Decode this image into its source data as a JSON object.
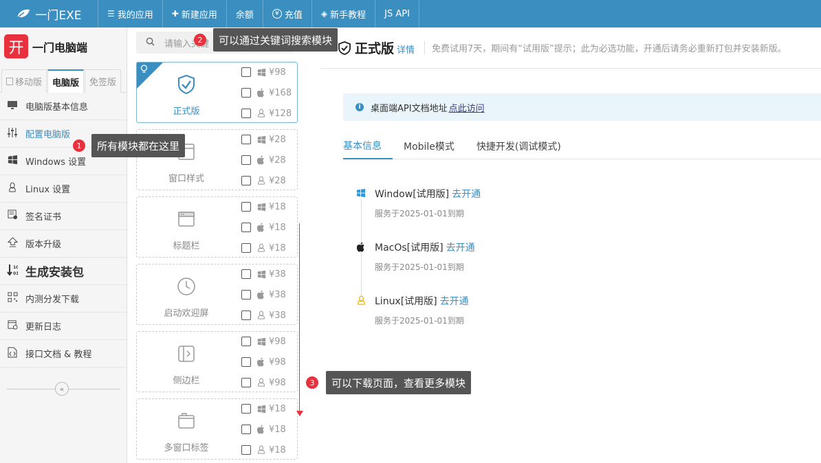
{
  "topbar": {
    "logo_text": "一门EXE",
    "nav": [
      {
        "icon": "hamburger-icon",
        "glyph": "☰",
        "label": "我的应用"
      },
      {
        "icon": "plus-icon",
        "glyph": "✚",
        "label": "新建应用"
      },
      {
        "icon": "",
        "glyph": "",
        "label": "余额"
      },
      {
        "icon": "yen-circle-icon",
        "glyph": "¥",
        "label": "充值"
      },
      {
        "icon": "diamond-icon",
        "glyph": "◈",
        "label": "新手教程"
      },
      {
        "icon": "",
        "glyph": "",
        "label": "JS API"
      }
    ]
  },
  "sidebar": {
    "app_icon_char": "开",
    "app_name": "一门电脑端",
    "version_tabs": [
      "移动版",
      "电脑版",
      "免签版"
    ],
    "items": [
      {
        "label": "电脑版基本信息",
        "icon": "monitor-icon",
        "glyph": "▭"
      },
      {
        "label": "配置电脑版",
        "icon": "sliders-icon",
        "glyph": "⫶"
      },
      {
        "label": "Windows 设置",
        "icon": "windows-icon",
        "glyph": "⊞"
      },
      {
        "label": "Linux 设置",
        "icon": "linux-icon",
        "glyph": "♙"
      },
      {
        "label": "签名证书",
        "icon": "certificate-icon",
        "glyph": "▤"
      },
      {
        "label": "版本升级",
        "icon": "upgrade-icon",
        "glyph": "⇧"
      },
      {
        "label": "生成安装包",
        "icon": "sort-icon",
        "glyph": "⇣"
      },
      {
        "label": "内测分发下载",
        "icon": "qrcode-icon",
        "glyph": "▦"
      },
      {
        "label": "更新日志",
        "icon": "calendar-icon",
        "glyph": "▣"
      },
      {
        "label": "接口文档 & 教程",
        "icon": "code-doc-icon",
        "glyph": "⎘"
      }
    ],
    "collapse_glyph": "«"
  },
  "modules": {
    "search_placeholder": "请输入关键",
    "cards": [
      {
        "name": "正式版",
        "icon": "shield-check-icon",
        "prices": [
          "¥98",
          "¥168",
          "¥128"
        ]
      },
      {
        "name": "窗口样式",
        "icon": "window-icon",
        "prices": [
          "¥28",
          "¥28",
          "¥28"
        ]
      },
      {
        "name": "标题栏",
        "icon": "titlebar-icon",
        "prices": [
          "¥18",
          "¥18",
          "¥18"
        ]
      },
      {
        "name": "启动欢迎屏",
        "icon": "clock-icon",
        "prices": [
          "¥38",
          "¥38",
          "¥38"
        ]
      },
      {
        "name": "侧边栏",
        "icon": "sidebar-icon",
        "prices": [
          "¥98",
          "¥98",
          "¥98"
        ]
      },
      {
        "name": "多窗口标签",
        "icon": "tabs-icon",
        "prices": [
          "¥18",
          "¥18",
          "¥18"
        ]
      }
    ]
  },
  "main": {
    "edition_title": "正式版",
    "detail_link": "详情",
    "edition_desc": "免费试用7天，期间有“试用版”提示；此为必选功能，开通后请务必重新打包并安装新版。",
    "notice_text": "桌面端API文档地址",
    "notice_link": "点此访问",
    "tabs": [
      "基本信息",
      "Mobile模式",
      "快捷开发(调试模式)"
    ],
    "platforms": [
      {
        "name": "Window[试用版]",
        "link": "去开通",
        "expire": "服务于2025-01-01到期",
        "icon": "windows-icon",
        "color": "#2b9be0"
      },
      {
        "name": "MacOs[试用版]",
        "link": "去开通",
        "expire": "服务于2025-01-01到期",
        "icon": "apple-icon",
        "color": "#222222"
      },
      {
        "name": "Linux[试用版]",
        "link": "去开通",
        "expire": "服务于2025-01-01到期",
        "icon": "linux-icon",
        "color": "#e8b100"
      }
    ]
  },
  "tips": [
    {
      "num": "1",
      "text": "所有模块都在这里"
    },
    {
      "num": "2",
      "text": "可以通过关键词搜索模块"
    },
    {
      "num": "3",
      "text": "可以下载页面，查看更多模块"
    }
  ],
  "colors": {
    "accent": "#3a8ec0",
    "danger": "#e8313c"
  }
}
